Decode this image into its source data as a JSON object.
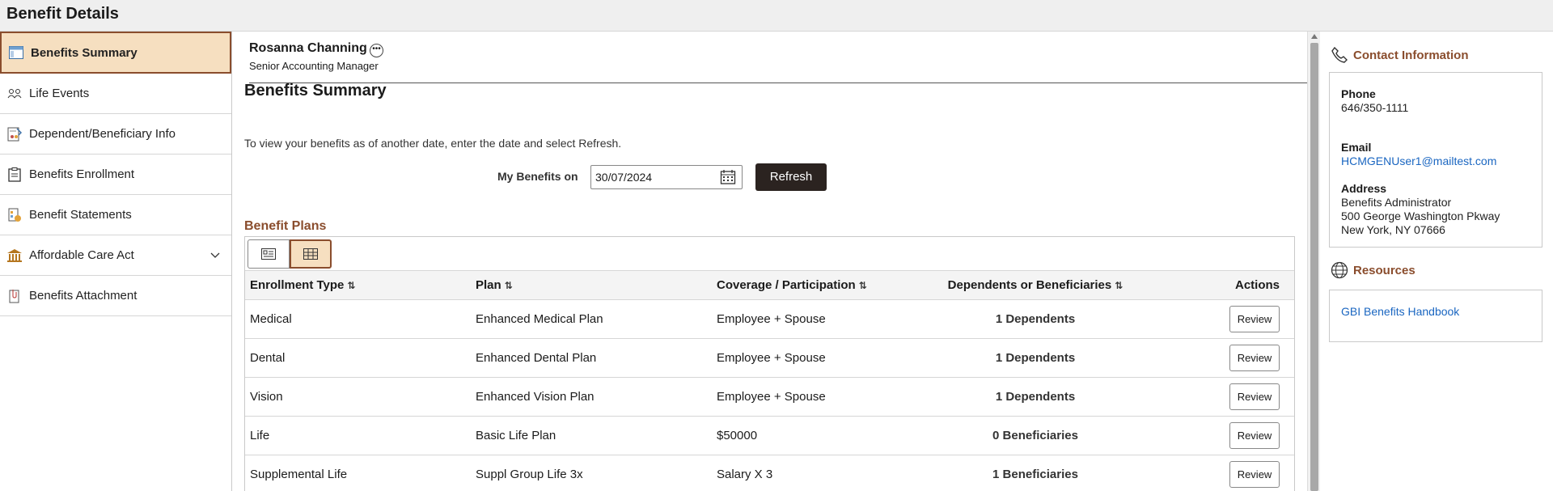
{
  "header": {
    "title": "Benefit Details"
  },
  "nav": {
    "items": [
      {
        "label": "Benefits Summary"
      },
      {
        "label": "Life Events"
      },
      {
        "label": "Dependent/Beneficiary Info"
      },
      {
        "label": "Benefits Enrollment"
      },
      {
        "label": "Benefit Statements"
      },
      {
        "label": "Affordable Care Act"
      },
      {
        "label": "Benefits Attachment"
      }
    ]
  },
  "person": {
    "name": "Rosanna Channing",
    "title": "Senior Accounting Manager"
  },
  "main": {
    "title": "Benefits Summary",
    "instructions": "To view your benefits as of another date, enter the date and select Refresh.",
    "date_label": "My Benefits on",
    "date_value": "30/07/2024",
    "refresh_label": "Refresh",
    "section_title": "Benefit Plans"
  },
  "table": {
    "headers": {
      "enrollment_type": "Enrollment Type",
      "plan": "Plan",
      "coverage": "Coverage / Participation",
      "dependents": "Dependents or Beneficiaries",
      "actions": "Actions"
    },
    "rows": [
      {
        "type": "Medical",
        "plan": "Enhanced Medical Plan",
        "coverage": "Employee + Spouse",
        "dependents": "1 Dependents",
        "action": "Review"
      },
      {
        "type": "Dental",
        "plan": "Enhanced Dental Plan",
        "coverage": "Employee + Spouse",
        "dependents": "1 Dependents",
        "action": "Review"
      },
      {
        "type": "Vision",
        "plan": "Enhanced Vision Plan",
        "coverage": "Employee + Spouse",
        "dependents": "1 Dependents",
        "action": "Review"
      },
      {
        "type": "Life",
        "plan": "Basic Life Plan",
        "coverage": "$50000",
        "dependents": "0 Beneficiaries",
        "action": "Review"
      },
      {
        "type": "Supplemental Life",
        "plan": "Suppl Group Life 3x",
        "coverage": "Salary X 3",
        "dependents": "1 Beneficiaries",
        "action": "Review"
      }
    ]
  },
  "contact": {
    "heading": "Contact Information",
    "phone_label": "Phone",
    "phone": "646/350-1111",
    "email_label": "Email",
    "email": "HCMGENUser1@mailtest.com",
    "address_label": "Address",
    "address_line1": "Benefits Administrator",
    "address_line2": "500 George Washington Pkway",
    "address_line3": "New York, NY 07666"
  },
  "resources": {
    "heading": "Resources",
    "link": "GBI Benefits Handbook"
  },
  "colors": {
    "accent": "#8a4d2d",
    "selected_bg": "#f6dfc0",
    "button_dark": "#2b2320",
    "link": "#1a66c1"
  }
}
